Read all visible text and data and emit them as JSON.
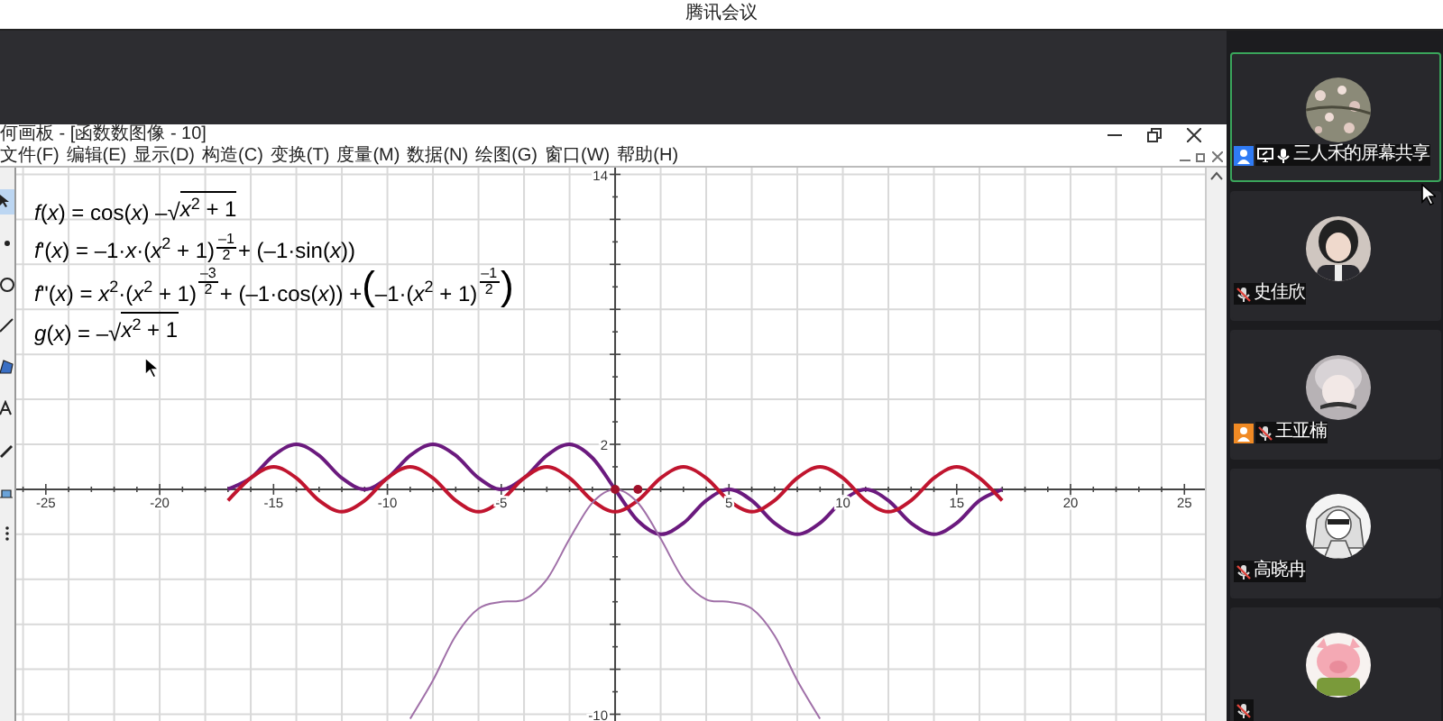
{
  "meeting": {
    "title": "腾讯会议"
  },
  "sketchpad": {
    "title": "何画板 - [函数数图像 - 10]",
    "menu": [
      "文件(F)",
      "编辑(E)",
      "显示(D)",
      "构造(C)",
      "变换(T)",
      "度量(M)",
      "数据(N)",
      "绘图(G)",
      "窗口(W)",
      "帮助(H)"
    ],
    "tools": [
      {
        "kind": "arrow",
        "selected": true
      },
      {
        "kind": "point",
        "selected": false
      },
      {
        "kind": "circle",
        "selected": false
      },
      {
        "kind": "line",
        "selected": false
      },
      {
        "kind": "polygon",
        "selected": false
      },
      {
        "kind": "text",
        "selected": false
      },
      {
        "kind": "marker",
        "selected": false
      },
      {
        "kind": "custom",
        "selected": false
      },
      {
        "kind": "more",
        "selected": false
      }
    ],
    "formulas": [
      {
        "parts": [
          {
            "kind": "text",
            "text": "*f*(*x*) = cos(*x*) – "
          },
          {
            "kind": "sqrt",
            "sign": "√",
            "text": "*x*$^{2}$ + 1"
          }
        ]
      },
      {
        "parts": [
          {
            "kind": "text",
            "text": "*f*'(*x*) = –1·*x*·(*x*$^{2}$ + 1)"
          },
          {
            "kind": "frac",
            "num": "–1",
            "den": "2"
          },
          {
            "kind": "text",
            "text": " + (–1·sin(*x*))"
          }
        ]
      },
      {
        "parts": [
          {
            "kind": "text",
            "text": "*f*''(*x*) = *x*$^{2}$·(*x*$^{2}$ + 1)"
          },
          {
            "kind": "frac",
            "num": "–3",
            "den": "2"
          },
          {
            "kind": "text",
            "text": " + (–1·cos(*x*)) + "
          },
          {
            "kind": "big",
            "text": "("
          },
          {
            "kind": "text",
            "text": "–1·(*x*$^{2}$ + 1)"
          },
          {
            "kind": "frac",
            "num": "–1",
            "den": "2"
          },
          {
            "kind": "big",
            "text": ")"
          }
        ]
      },
      {
        "parts": [
          {
            "kind": "text",
            "text": "*g*(*x*) = –"
          },
          {
            "kind": "sqrt",
            "sign": "√",
            "text": "*x*$^{2}$ + 1"
          }
        ]
      }
    ],
    "chart_data": {
      "type": "line",
      "grid": true,
      "x": [
        -17,
        -16,
        -15,
        -14,
        -13,
        -12,
        -11,
        -10,
        -9,
        -8,
        -7,
        -6,
        -5,
        -4,
        -3,
        -2,
        -1,
        0,
        1,
        2,
        3,
        4,
        5,
        6,
        7,
        8,
        9,
        10,
        11,
        12,
        13,
        14,
        15,
        16,
        17
      ],
      "series": [
        {
          "color": "#6b1a7e",
          "values": [
            0,
            0.5,
            1.5,
            2,
            1.5,
            0.5,
            0,
            0.5,
            1.5,
            2,
            1.5,
            0.5,
            0,
            0.5,
            1.5,
            2,
            1.4,
            0,
            -1.4,
            -2,
            -1.5,
            -0.5,
            0,
            -0.5,
            -1.5,
            -2,
            -1.5,
            -0.5,
            0,
            -0.5,
            -1.5,
            -2,
            -1.5,
            -0.5,
            0
          ]
        },
        {
          "color": "#c0152f",
          "values": [
            -0.5,
            0.5,
            1,
            0.5,
            -0.5,
            -1,
            -0.5,
            0.5,
            1,
            0.5,
            -0.5,
            -1,
            -0.5,
            0.5,
            1,
            0.5,
            -0.5,
            -1,
            -0.5,
            0.5,
            1,
            0.5,
            -0.5,
            -1,
            -0.5,
            0.5,
            1,
            0.5,
            -0.5,
            -1,
            -0.5,
            0.5,
            1,
            0.5,
            -0.5
          ]
        },
        {
          "color": "#a070a8",
          "values": [
            null,
            null,
            null,
            null,
            null,
            null,
            null,
            null,
            -10.2,
            -8.5,
            -6.5,
            -5.3,
            -5,
            -4.9,
            -4,
            -2.2,
            -0.6,
            0,
            -0.6,
            -2.2,
            -4,
            -4.9,
            -5,
            -5.3,
            -6.5,
            -8.5,
            -10.2,
            null,
            null,
            null,
            null,
            null,
            null,
            null,
            null
          ]
        },
        {
          "type": "scatter",
          "color": "#a0102a",
          "values": [
            null,
            null,
            null,
            null,
            null,
            null,
            null,
            null,
            null,
            null,
            null,
            null,
            null,
            null,
            null,
            null,
            null,
            0,
            0,
            null,
            null,
            null,
            null,
            null,
            null,
            null,
            null,
            null,
            null,
            null,
            null,
            null,
            null,
            null,
            null
          ]
        }
      ],
      "xlim": [
        -26.3,
        25.9
      ],
      "ylim": [
        -10.3,
        14.3
      ],
      "xticks": [
        -25,
        -20,
        -15,
        -10,
        -5,
        5,
        10,
        15,
        20,
        25
      ],
      "yticks": [
        14,
        2,
        -10
      ]
    }
  },
  "participants": [
    {
      "name": "三人禾的屏幕共享",
      "color": "#2f7bf5",
      "sharing": true,
      "muted": false,
      "selected": true
    },
    {
      "name": "史佳欣",
      "sharing": false,
      "muted": true,
      "selected": false
    },
    {
      "name": "王亚楠",
      "color": "#f08a24",
      "sharing": false,
      "muted": true,
      "selected": false
    },
    {
      "name": "高晓冉",
      "sharing": false,
      "muted": true,
      "selected": false
    },
    {
      "sharing": false,
      "muted": true,
      "selected": false
    }
  ]
}
